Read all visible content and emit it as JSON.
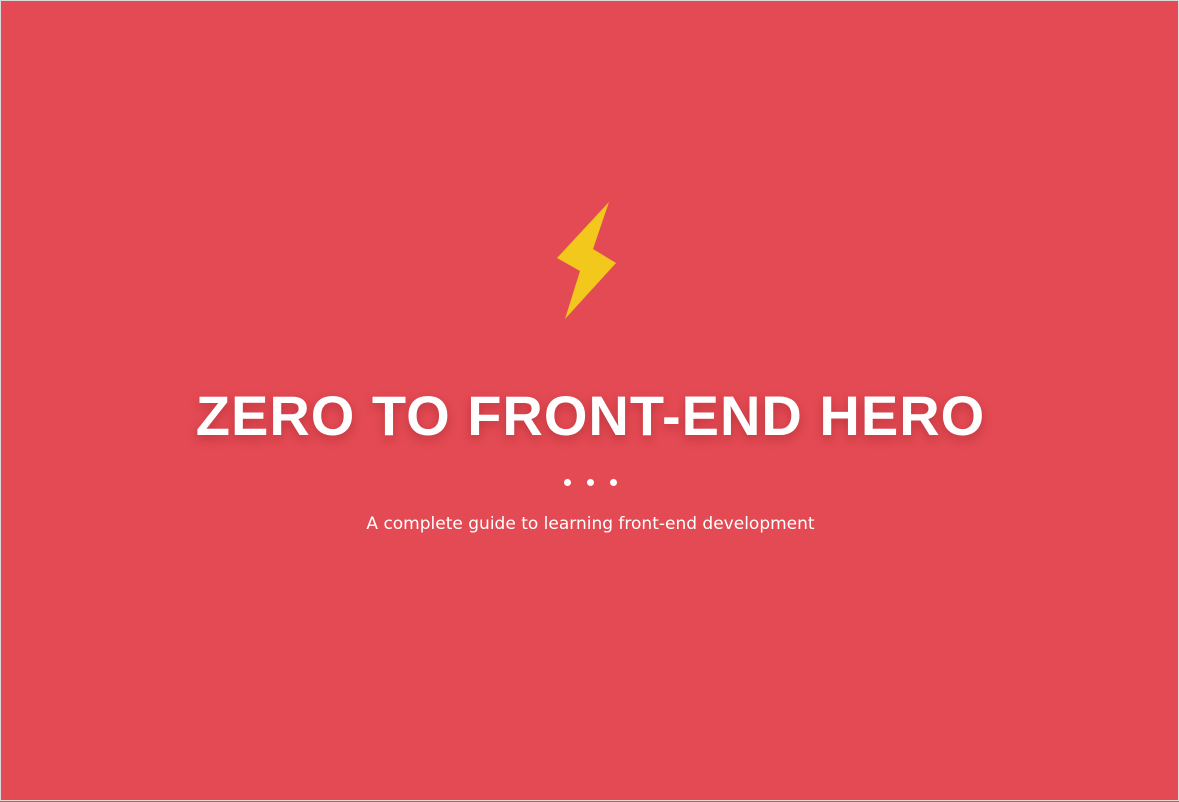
{
  "hero": {
    "icon": "lightning-bolt-icon",
    "title": "ZERO TO FRONT-END HERO",
    "subtitle": "A complete guide to learning front-end development"
  },
  "colors": {
    "background": "#e44a53",
    "bolt": "#f2c81d",
    "text": "#ffffff"
  }
}
